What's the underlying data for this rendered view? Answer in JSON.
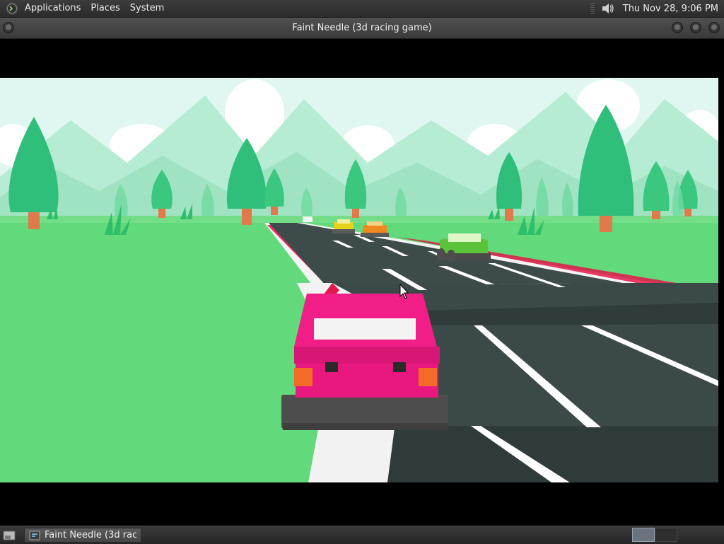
{
  "top_panel": {
    "menus": [
      "Applications",
      "Places",
      "System"
    ],
    "clock": "Thu Nov 28,  9:06 PM",
    "icons": {
      "logo": "terminal-logo-icon",
      "volume": "speaker-volume-icon"
    }
  },
  "window": {
    "title": "Faint Needle (3d racing game)"
  },
  "taskbar": {
    "task_label": "Faint Needle (3d rac...",
    "icons": {
      "show_desktop": "show-desktop-icon",
      "task": "app-window-icon"
    }
  },
  "colors": {
    "sky": "#dff6f1",
    "mountains": "#a4e6c8",
    "grass": "#62d97a",
    "road": "#3b4a48",
    "curb_red": "#e3174a",
    "player_car": "#e8187e"
  }
}
